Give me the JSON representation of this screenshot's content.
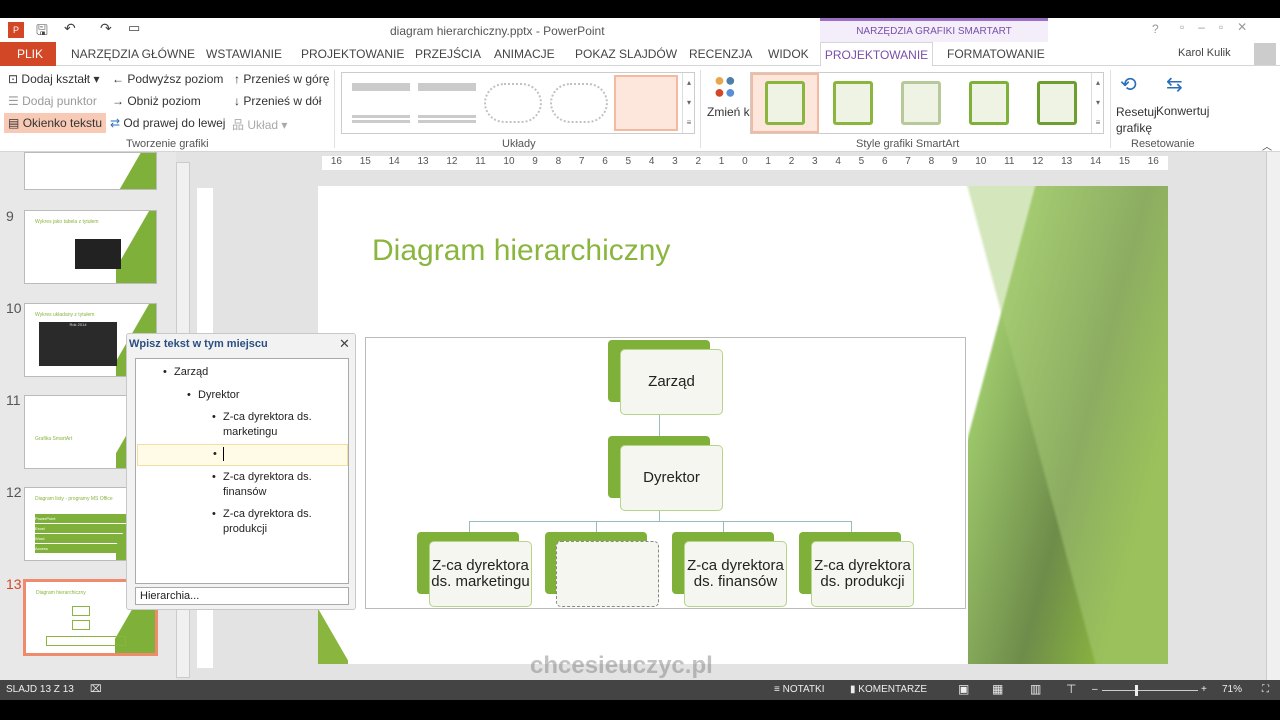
{
  "window": {
    "title": "diagram hierarchiczny.pptx - PowerPoint",
    "context_tab_group": "NARZĘDZIA GRAFIKI SMARTART",
    "user": "Karol Kulik",
    "help": "?"
  },
  "tabs": [
    "PLIK",
    "NARZĘDZIA GŁÓWNE",
    "WSTAWIANIE",
    "PROJEKTOWANIE",
    "PRZEJŚCIA",
    "ANIMACJE",
    "POKAZ SLAJDÓW",
    "RECENZJA",
    "WIDOK",
    "PROJEKTOWANIE",
    "FORMATOWANIE"
  ],
  "ribbon": {
    "create": {
      "add_shape": "Dodaj kształt",
      "add_bullet": "Dodaj punktor",
      "text_pane": "Okienko tekstu",
      "promote": "Podwyższ poziom",
      "demote": "Obniż poziom",
      "rtl": "Od prawej do lewej",
      "move_up": "Przenieś w górę",
      "move_down": "Przenieś w dół",
      "layout": "Układ",
      "group": "Tworzenie grafiki"
    },
    "layouts": {
      "group": "Układy"
    },
    "styles": {
      "change_colors": "Zmień kolory",
      "group": "Style grafiki SmartArt"
    },
    "reset": {
      "reset": "Resetuj grafikę",
      "convert": "Konwertuj",
      "group": "Resetowanie"
    }
  },
  "ruler": [
    "16",
    "15",
    "14",
    "13",
    "12",
    "11",
    "10",
    "9",
    "8",
    "7",
    "6",
    "5",
    "4",
    "3",
    "2",
    "1",
    "0",
    "1",
    "2",
    "3",
    "4",
    "5",
    "6",
    "7",
    "8",
    "9",
    "10",
    "11",
    "12",
    "13",
    "14",
    "15",
    "16"
  ],
  "thumbnails": [
    {
      "num": "9",
      "title": "Wykres jako tabela z tytułem"
    },
    {
      "num": "10",
      "title": "Wykres układany z tytułem",
      "chart": "Rok 2014"
    },
    {
      "num": "11",
      "title": "Grafika SmartArt"
    },
    {
      "num": "12",
      "title": "Diagram listy - programy MS Office",
      "items": [
        "PowerPoint",
        "Excel",
        "Word",
        "Access"
      ]
    },
    {
      "num": "13",
      "title": "Diagram hierarchiczny"
    }
  ],
  "slide": {
    "title": "Diagram hierarchiczny",
    "nodes": {
      "top": "Zarząd",
      "mid": "Dyrektor",
      "children": [
        "Z-ca dyrektora ds. marketingu",
        "",
        "Z-ca dyrektora ds. finansów",
        "Z-ca dyrektora ds. produkcji"
      ]
    }
  },
  "text_pane": {
    "title": "Wpisz tekst w tym miejscu",
    "items": [
      "Zarząd",
      "Dyrektor",
      "Z-ca dyrektora ds. marketingu",
      "",
      "Z-ca dyrektora ds. finansów",
      "Z-ca dyrektora ds. produkcji"
    ],
    "footer": "Hierarchia..."
  },
  "watermark": "chcesieuczyc.pl",
  "status": {
    "slide": "SLAJD 13 Z 13",
    "notes": "NOTATKI",
    "comments": "KOMENTARZE",
    "zoom": "71%",
    "zoom_value": 71
  },
  "colors": {
    "accent": "#7fb03a",
    "title": "#8ab53f",
    "ppt": "#d24726",
    "context": "#9b6fc4"
  }
}
